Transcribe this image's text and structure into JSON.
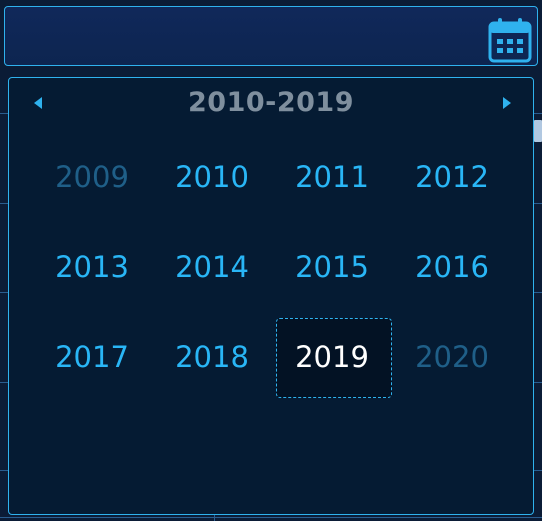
{
  "picker": {
    "range_title": "2010-2019",
    "years": [
      {
        "label": "2009",
        "state": "out-of-range"
      },
      {
        "label": "2010",
        "state": "normal"
      },
      {
        "label": "2011",
        "state": "normal"
      },
      {
        "label": "2012",
        "state": "normal"
      },
      {
        "label": "2013",
        "state": "normal"
      },
      {
        "label": "2014",
        "state": "normal"
      },
      {
        "label": "2015",
        "state": "normal"
      },
      {
        "label": "2016",
        "state": "normal"
      },
      {
        "label": "2017",
        "state": "normal"
      },
      {
        "label": "2018",
        "state": "normal"
      },
      {
        "label": "2019",
        "state": "selected"
      },
      {
        "label": "2020",
        "state": "out-of-range"
      }
    ],
    "prev_icon": "caret-left-icon",
    "next_icon": "caret-right-icon"
  },
  "input": {
    "icon": "calendar-icon"
  },
  "colors": {
    "accent": "#2fb2ee",
    "year_text": "#29b6f6",
    "muted_text": "#1f5f88",
    "title_text": "#7f8f9e",
    "panel_bg": "#051b33",
    "selected_text": "#ffffff"
  }
}
